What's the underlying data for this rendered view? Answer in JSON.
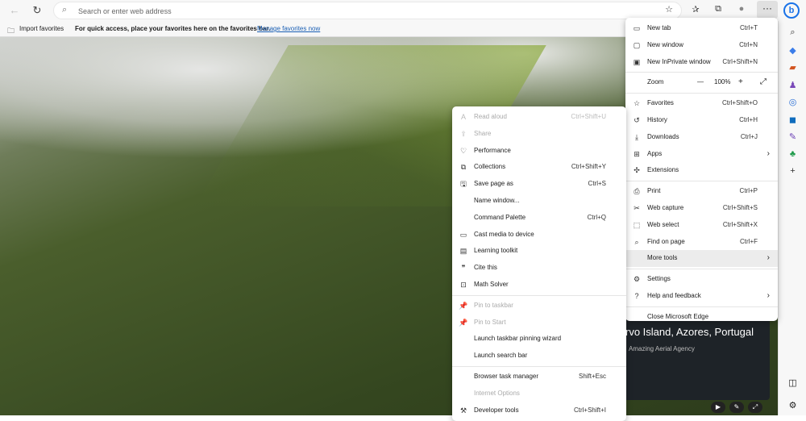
{
  "toolbar": {
    "address_placeholder": "Search or enter web address",
    "icons": [
      "back-icon",
      "refresh-icon",
      "search-icon",
      "add-favorite-icon",
      "favorites-icon",
      "collections-icon",
      "profile-icon",
      "more-icon"
    ]
  },
  "favorites_bar": {
    "import_label": "Import favorites",
    "hint": "For quick access, place your favorites here on the favorites bar.",
    "manage_link": "Manage favorites now"
  },
  "video_card": {
    "title": "rvo Island, Azores, Portugal",
    "credit": "Amazing Aerial Agency"
  },
  "main_menu": [
    {
      "icon": "▭",
      "name": "new-tab",
      "label": "New tab",
      "shortcut": "Ctrl+T"
    },
    {
      "icon": "▢",
      "name": "new-window",
      "label": "New window",
      "shortcut": "Ctrl+N"
    },
    {
      "icon": "▣",
      "name": "new-inprivate-window",
      "label": "New InPrivate window",
      "shortcut": "Ctrl+Shift+N"
    },
    {
      "divider": true
    },
    {
      "zoom": true,
      "label": "Zoom",
      "value": "100%"
    },
    {
      "divider": true
    },
    {
      "icon": "☆",
      "name": "favorites",
      "label": "Favorites",
      "shortcut": "Ctrl+Shift+O"
    },
    {
      "icon": "↺",
      "name": "history",
      "label": "History",
      "shortcut": "Ctrl+H"
    },
    {
      "icon": "⤓",
      "name": "downloads",
      "label": "Downloads",
      "shortcut": "Ctrl+J"
    },
    {
      "icon": "⊞",
      "name": "apps",
      "label": "Apps",
      "arrow": true
    },
    {
      "icon": "✣",
      "name": "extensions",
      "label": "Extensions"
    },
    {
      "divider": true
    },
    {
      "icon": "⎙",
      "name": "print",
      "label": "Print",
      "shortcut": "Ctrl+P"
    },
    {
      "icon": "✂",
      "name": "web-capture",
      "label": "Web capture",
      "shortcut": "Ctrl+Shift+S"
    },
    {
      "icon": "⬚",
      "name": "web-select",
      "label": "Web select",
      "shortcut": "Ctrl+Shift+X"
    },
    {
      "icon": "⌕",
      "name": "find-on-page",
      "label": "Find on page",
      "shortcut": "Ctrl+F"
    },
    {
      "icon": "",
      "name": "more-tools",
      "label": "More tools",
      "arrow": true,
      "highlight": true
    },
    {
      "divider": true
    },
    {
      "icon": "⚙",
      "name": "settings",
      "label": "Settings"
    },
    {
      "icon": "?",
      "name": "help-and-feedback",
      "label": "Help and feedback",
      "arrow": true
    },
    {
      "divider": true
    },
    {
      "icon": "",
      "name": "close-microsoft-edge",
      "label": "Close Microsoft Edge"
    }
  ],
  "more_tools_menu": [
    {
      "icon": "A",
      "name": "read-aloud",
      "label": "Read aloud",
      "shortcut": "Ctrl+Shift+U",
      "disabled": true
    },
    {
      "icon": "⇪",
      "name": "share",
      "label": "Share",
      "disabled": true
    },
    {
      "icon": "♡",
      "name": "performance",
      "label": "Performance"
    },
    {
      "icon": "⧉",
      "name": "collections",
      "label": "Collections",
      "shortcut": "Ctrl+Shift+Y"
    },
    {
      "icon": "🖫",
      "name": "save-page-as",
      "label": "Save page as",
      "shortcut": "Ctrl+S"
    },
    {
      "icon": "",
      "name": "name-window",
      "label": "Name window..."
    },
    {
      "icon": "",
      "name": "command-palette",
      "label": "Command Palette",
      "shortcut": "Ctrl+Q"
    },
    {
      "icon": "▭",
      "name": "cast-media",
      "label": "Cast media to device"
    },
    {
      "icon": "▤",
      "name": "learning-toolkit",
      "label": "Learning toolkit"
    },
    {
      "icon": "❞",
      "name": "cite-this",
      "label": "Cite this"
    },
    {
      "icon": "⊡",
      "name": "math-solver",
      "label": "Math Solver"
    },
    {
      "divider": true
    },
    {
      "icon": "📌",
      "name": "pin-to-taskbar",
      "label": "Pin to taskbar",
      "disabled": true
    },
    {
      "icon": "📌",
      "name": "pin-to-start",
      "label": "Pin to Start",
      "disabled": true
    },
    {
      "icon": "",
      "name": "launch-taskbar-pinning-wizard",
      "label": "Launch taskbar pinning wizard"
    },
    {
      "icon": "",
      "name": "launch-search-bar",
      "label": "Launch search bar"
    },
    {
      "divider": true
    },
    {
      "icon": "",
      "name": "browser-task-manager",
      "label": "Browser task manager",
      "shortcut": "Shift+Esc"
    },
    {
      "icon": "",
      "name": "internet-options",
      "label": "Internet Options",
      "disabled": true
    },
    {
      "icon": "⚒",
      "name": "developer-tools",
      "label": "Developer tools",
      "shortcut": "Ctrl+Shift+I"
    }
  ],
  "sidebar": [
    {
      "name": "search-icon",
      "glyph": "⌕",
      "color": "#333"
    },
    {
      "name": "shopping-icon",
      "glyph": "◆",
      "color": "#3b7de9"
    },
    {
      "name": "tools-icon",
      "glyph": "▰",
      "color": "#d2531f"
    },
    {
      "name": "games-icon",
      "glyph": "♟",
      "color": "#7a4ab8"
    },
    {
      "name": "office-icon",
      "glyph": "◎",
      "color": "#2a6fd6"
    },
    {
      "name": "outlook-icon",
      "glyph": "◼",
      "color": "#0f6cbd"
    },
    {
      "name": "drop-icon",
      "glyph": "✎",
      "color": "#6a3fb5"
    },
    {
      "name": "tree-icon",
      "glyph": "♣",
      "color": "#1e9a4a"
    },
    {
      "name": "add-icon",
      "glyph": "+",
      "color": "#333"
    }
  ]
}
